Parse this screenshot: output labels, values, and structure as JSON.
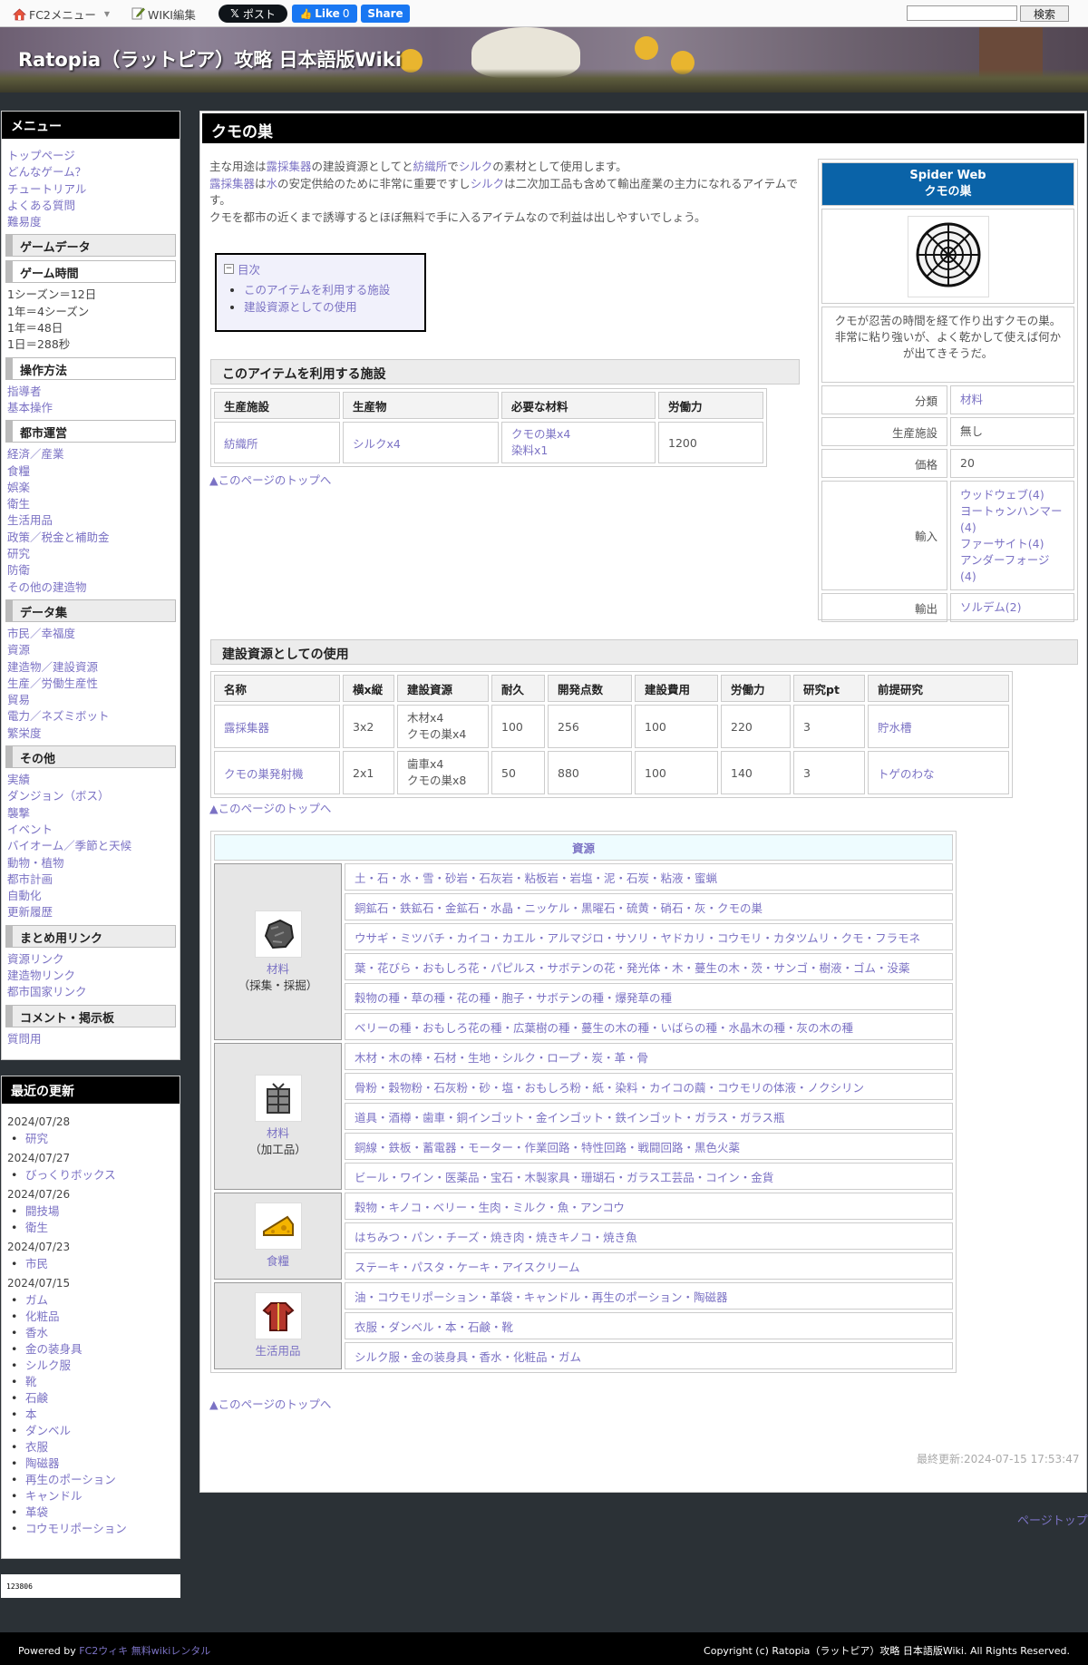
{
  "topbar": {
    "fc2_menu": "FC2メニュー",
    "wiki_edit": "WIKI編集",
    "x_post": "ポスト",
    "fb_like": "Like",
    "fb_like_count": "0",
    "fb_share": "Share",
    "search_placeholder": "",
    "search_button": "検索"
  },
  "site_title": "Ratopia（ラットピア）攻略 日本語版Wiki",
  "sidebar": {
    "menu_title": "メニュー",
    "top_links": [
      "トップページ",
      "どんなゲーム？",
      "チュートリアル",
      "よくある質問",
      "難易度"
    ],
    "section_gamedata": "ゲームデータ",
    "sub_gametime": "ゲーム時間",
    "gametime_lines": [
      "1シーズン＝12日",
      "1年＝4シーズン",
      "1年＝48日",
      "1日＝288秒"
    ],
    "sub_controls": "操作方法",
    "controls_links": [
      "指導者",
      "基本操作"
    ],
    "sub_city": "都市運営",
    "city_links": [
      "経済／産業",
      "食糧",
      "娯楽",
      "衛生",
      "生活用品",
      "政策／税金と補助金",
      "研究",
      "防衛",
      "その他の建造物"
    ],
    "section_data": "データ集",
    "data_links": [
      "市民／幸福度",
      "資源",
      "建造物／建設資源",
      "生産／労働生産性",
      "貿易",
      "電力／ネズミボット",
      "繁栄度"
    ],
    "section_other": "その他",
    "other_links": [
      "実績",
      "ダンジョン（ボス）",
      "襲撃",
      "イベント",
      "バイオーム／季節と天候",
      "動物・植物",
      "都市計画",
      "自動化",
      "更新履歴"
    ],
    "section_links": "まとめ用リンク",
    "summary_links": [
      "資源リンク",
      "建造物リンク",
      "都市国家リンク"
    ],
    "section_comment": "コメント・掲示板",
    "comment_links": [
      "質問用"
    ]
  },
  "recent": {
    "title": "最近の更新",
    "groups": [
      {
        "date": "2024/07/28",
        "items": [
          "研究"
        ]
      },
      {
        "date": "2024/07/27",
        "items": [
          "びっくりボックス"
        ]
      },
      {
        "date": "2024/07/26",
        "items": [
          "闘技場",
          "衛生"
        ]
      },
      {
        "date": "2024/07/23",
        "items": [
          "市民"
        ]
      },
      {
        "date": "2024/07/15",
        "items": [
          "ガム",
          "化粧品",
          "香水",
          "金の装身具",
          "シルク服",
          "靴",
          "石鹸",
          "本",
          "ダンベル",
          "衣服",
          "陶磁器",
          "再生のポーション",
          "キャンドル",
          "革袋",
          "コウモリポーション"
        ]
      }
    ]
  },
  "counter": "123806",
  "main": {
    "page_title": "クモの巣",
    "intro": [
      [
        {
          "t": "主な用途は"
        },
        {
          "l": "露採集器"
        },
        {
          "t": "の建設資源としてと"
        },
        {
          "l": "紡織所"
        },
        {
          "t": "で"
        },
        {
          "l": "シルク"
        },
        {
          "t": "の素材として使用します。"
        }
      ],
      [
        {
          "l": "露採集器"
        },
        {
          "t": "は"
        },
        {
          "l": "水"
        },
        {
          "t": "の安定供給のために非常に重要ですし"
        },
        {
          "l": "シルク"
        },
        {
          "t": "は二次加工品も含めて輸出産業の主力になれるアイテムです。"
        }
      ],
      [
        {
          "t": "クモを都市の近くまで誘導するとほぼ無料で手に入るアイテムなので利益は出しやすいでしょう。"
        }
      ]
    ],
    "toc": {
      "title": "目次",
      "items": [
        "このアイテムを利用する施設",
        "建設資源としての使用"
      ]
    },
    "section1": {
      "title": "このアイテムを利用する施設",
      "headers": [
        "生産施設",
        "生産物",
        "必要な材料",
        "労働力"
      ],
      "row": {
        "facility": "紡織所",
        "product": "シルクx4",
        "materials": [
          "クモの巣x4",
          "染料x1"
        ],
        "labor": "1200"
      }
    },
    "back_to_top": "▲このページのトップへ",
    "section2": {
      "title": "建設資源としての使用",
      "headers": [
        "名称",
        "横x縦",
        "建設資源",
        "耐久",
        "開発点数",
        "建設費用",
        "労働力",
        "研究pt",
        "前提研究"
      ],
      "rows": [
        {
          "name": "露採集器",
          "size": "3x2",
          "res": [
            "木材x4",
            "クモの巣x4"
          ],
          "durability": "100",
          "dev": "256",
          "cost": "100",
          "labor": "220",
          "research": "3",
          "prereq": "貯水槽"
        },
        {
          "name": "クモの巣発射機",
          "size": "2x1",
          "res": [
            "歯車x4",
            "クモの巣x8"
          ],
          "durability": "50",
          "dev": "880",
          "cost": "100",
          "labor": "140",
          "research": "3",
          "prereq": "トゲのわな"
        }
      ]
    },
    "infobox": {
      "title_en": "Spider Web",
      "title_ja": "クモの巣",
      "description": "クモが忍苦の時間を経て作り出すクモの巣。非常に粘り強いが、よく乾かして使えば何かが出てきそうだ。",
      "rows": [
        {
          "key": "分類",
          "value": [
            "材料"
          ]
        },
        {
          "key": "生産施設",
          "value": [
            "無し"
          ]
        },
        {
          "key": "価格",
          "value": [
            "20"
          ]
        },
        {
          "key": "輸入",
          "value": [
            "ウッドウェブ(4)",
            "ヨートゥンハンマー(4)",
            "ファーサイト(4)",
            "アンダーフォージ(4)"
          ]
        },
        {
          "key": "輸出",
          "value": [
            "ソルデム(2)"
          ]
        }
      ]
    },
    "resources": {
      "title": "資源",
      "categories": [
        {
          "name": "材料",
          "sub": "（採集・採掘）",
          "icon": "rock-icon",
          "rows": [
            "土・石・水・雪・砂岩・石灰岩・粘板岩・岩塩・泥・石炭・粘液・蜜蝋",
            "銅鉱石・鉄鉱石・金鉱石・水晶・ニッケル・黒曜石・硫黄・硝石・灰・クモの巣",
            "ウサギ・ミツバチ・カイコ・カエル・アルマジロ・サソリ・ヤドカリ・コウモリ・カタツムリ・クモ・フラモネ",
            "葉・花びら・おもしろ花・パピルス・サボテンの花・発光体・木・蔓生の木・茨・サンゴ・樹液・ゴム・没薬",
            "穀物の種・草の種・花の種・胞子・サボテンの種・爆発草の種",
            "ベリーの種・おもしろ花の種・広葉樹の種・蔓生の木の種・いばらの種・水晶木の種・灰の木の種"
          ]
        },
        {
          "name": "材料",
          "sub": "（加工品）",
          "icon": "crate-icon",
          "rows": [
            "木材・木の棒・石材・生地・シルク・ロープ・炭・革・骨",
            "骨粉・穀物粉・石灰粉・砂・塩・おもしろ粉・紙・染料・カイコの繭・コウモリの体液・ノクシリン",
            "道具・酒樽・歯車・銅インゴット・金インゴット・鉄インゴット・ガラス・ガラス瓶",
            "銅線・鉄板・蓄電器・モーター・作業回路・特性回路・戦闘回路・黒色火薬",
            "ビール・ワイン・医薬品・宝石・木製家具・珊瑚石・ガラス工芸品・コイン・金貨"
          ]
        },
        {
          "name": "食糧",
          "sub": "",
          "icon": "cheese-icon",
          "rows": [
            "穀物・キノコ・ベリー・生肉・ミルク・魚・アンコウ",
            "はちみつ・パン・チーズ・焼き肉・焼きキノコ・焼き魚",
            "ステーキ・パスタ・ケーキ・アイスクリーム"
          ]
        },
        {
          "name": "生活用品",
          "sub": "",
          "icon": "clothes-icon",
          "rows": [
            "油・コウモリポーション・革袋・キャンドル・再生のポーション・陶磁器",
            "衣服・ダンベル・本・石鹸・靴",
            "シルク服・金の装身具・香水・化粧品・ガム"
          ]
        }
      ]
    },
    "last_updated": "最終更新:2024-07-15 17:53:47"
  },
  "page_top": "ページトップ",
  "footer": {
    "powered_prefix": "Powered by ",
    "powered_link": "FC2ウィキ 無料wikiレンタル",
    "copyright": "Copyright (c) Ratopia（ラットピア）攻略 日本語版Wiki. All Rights Reserved."
  },
  "colors": {
    "accent_link": "#7b72c4",
    "infobox_header": "#0a63a8",
    "resource_header": "#eefcff"
  }
}
